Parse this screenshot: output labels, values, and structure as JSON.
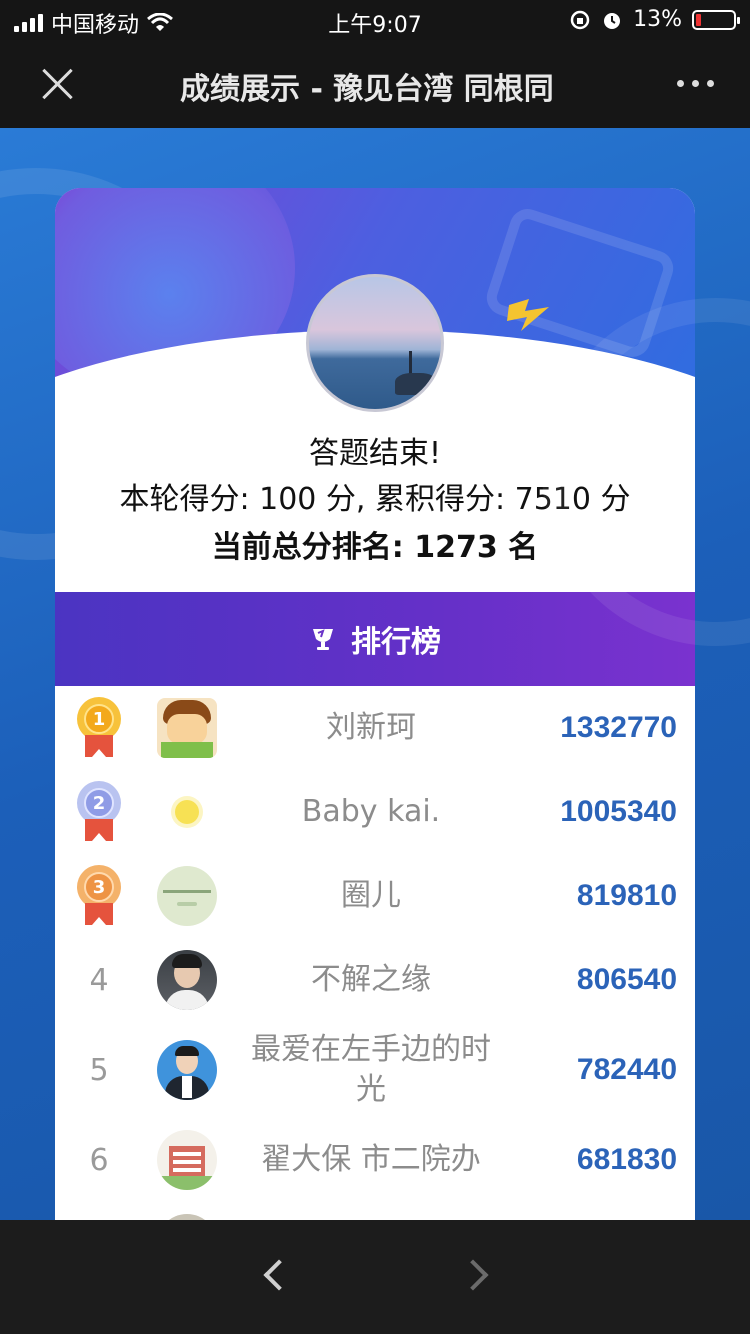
{
  "status": {
    "carrier": "中国移动",
    "time": "上午9:07",
    "battery": "13%"
  },
  "header": {
    "title": "成绩展示 - 豫见台湾 同根同"
  },
  "result": {
    "line1": "答题结束!",
    "line2": "本轮得分: 100 分, 累积得分: 7510 分",
    "line3": "当前总分排名: 1273 名"
  },
  "leaderboard": {
    "title": "排行榜",
    "rows": [
      {
        "rank": "1",
        "name": "刘新珂",
        "score": "1332770"
      },
      {
        "rank": "2",
        "name": "Baby kai.",
        "score": "1005340"
      },
      {
        "rank": "3",
        "name": "圈儿",
        "score": "819810"
      },
      {
        "rank": "4",
        "name": "不解之缘",
        "score": "806540"
      },
      {
        "rank": "5",
        "name": "最爱在左手边的时光",
        "score": "782440"
      },
      {
        "rank": "6",
        "name": "翟大保 市二院办",
        "score": "681830"
      }
    ]
  }
}
